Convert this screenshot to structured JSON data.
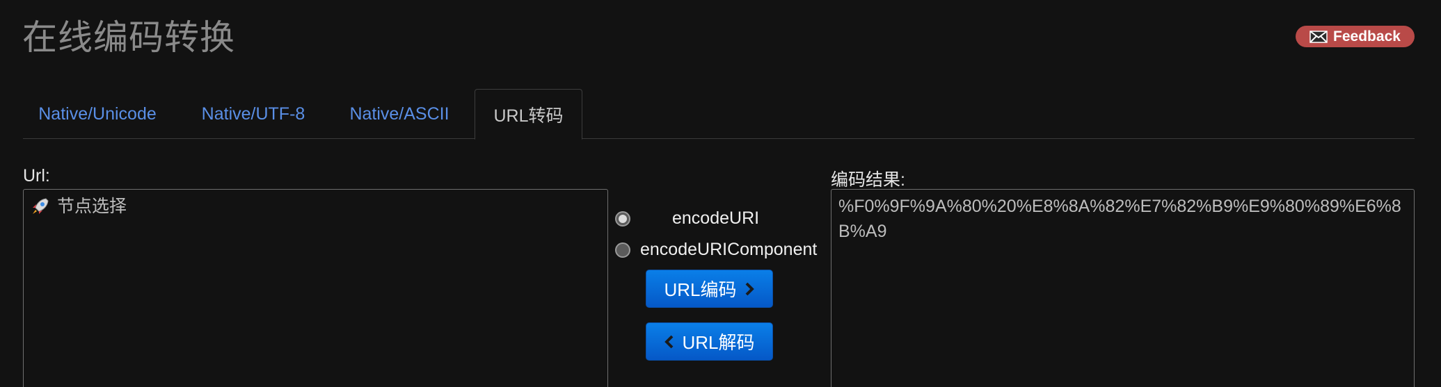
{
  "header": {
    "title": "在线编码转换",
    "feedback_label": "Feedback"
  },
  "tabs": [
    {
      "label": "Native/Unicode",
      "active": false
    },
    {
      "label": "Native/UTF-8",
      "active": false
    },
    {
      "label": "Native/ASCII",
      "active": false
    },
    {
      "label": "URL转码",
      "active": true
    }
  ],
  "input": {
    "label": "Url:",
    "value": "节点选择",
    "icon": "rocket-icon"
  },
  "options": {
    "encode_uri_label": "encodeURI",
    "encode_uri_component_label": "encodeURIComponent",
    "selected": "encodeURI"
  },
  "buttons": {
    "encode_label": "URL编码",
    "decode_label": "URL解码"
  },
  "output": {
    "label": "编码结果:",
    "value": "%F0%9F%9A%80%20%E8%8A%82%E7%82%B9%E9%80%89%E6%8B%A9"
  },
  "colors": {
    "background": "#121212",
    "link": "#5a8fe6",
    "feedback": "#b94a48",
    "button": "#0668d6"
  }
}
